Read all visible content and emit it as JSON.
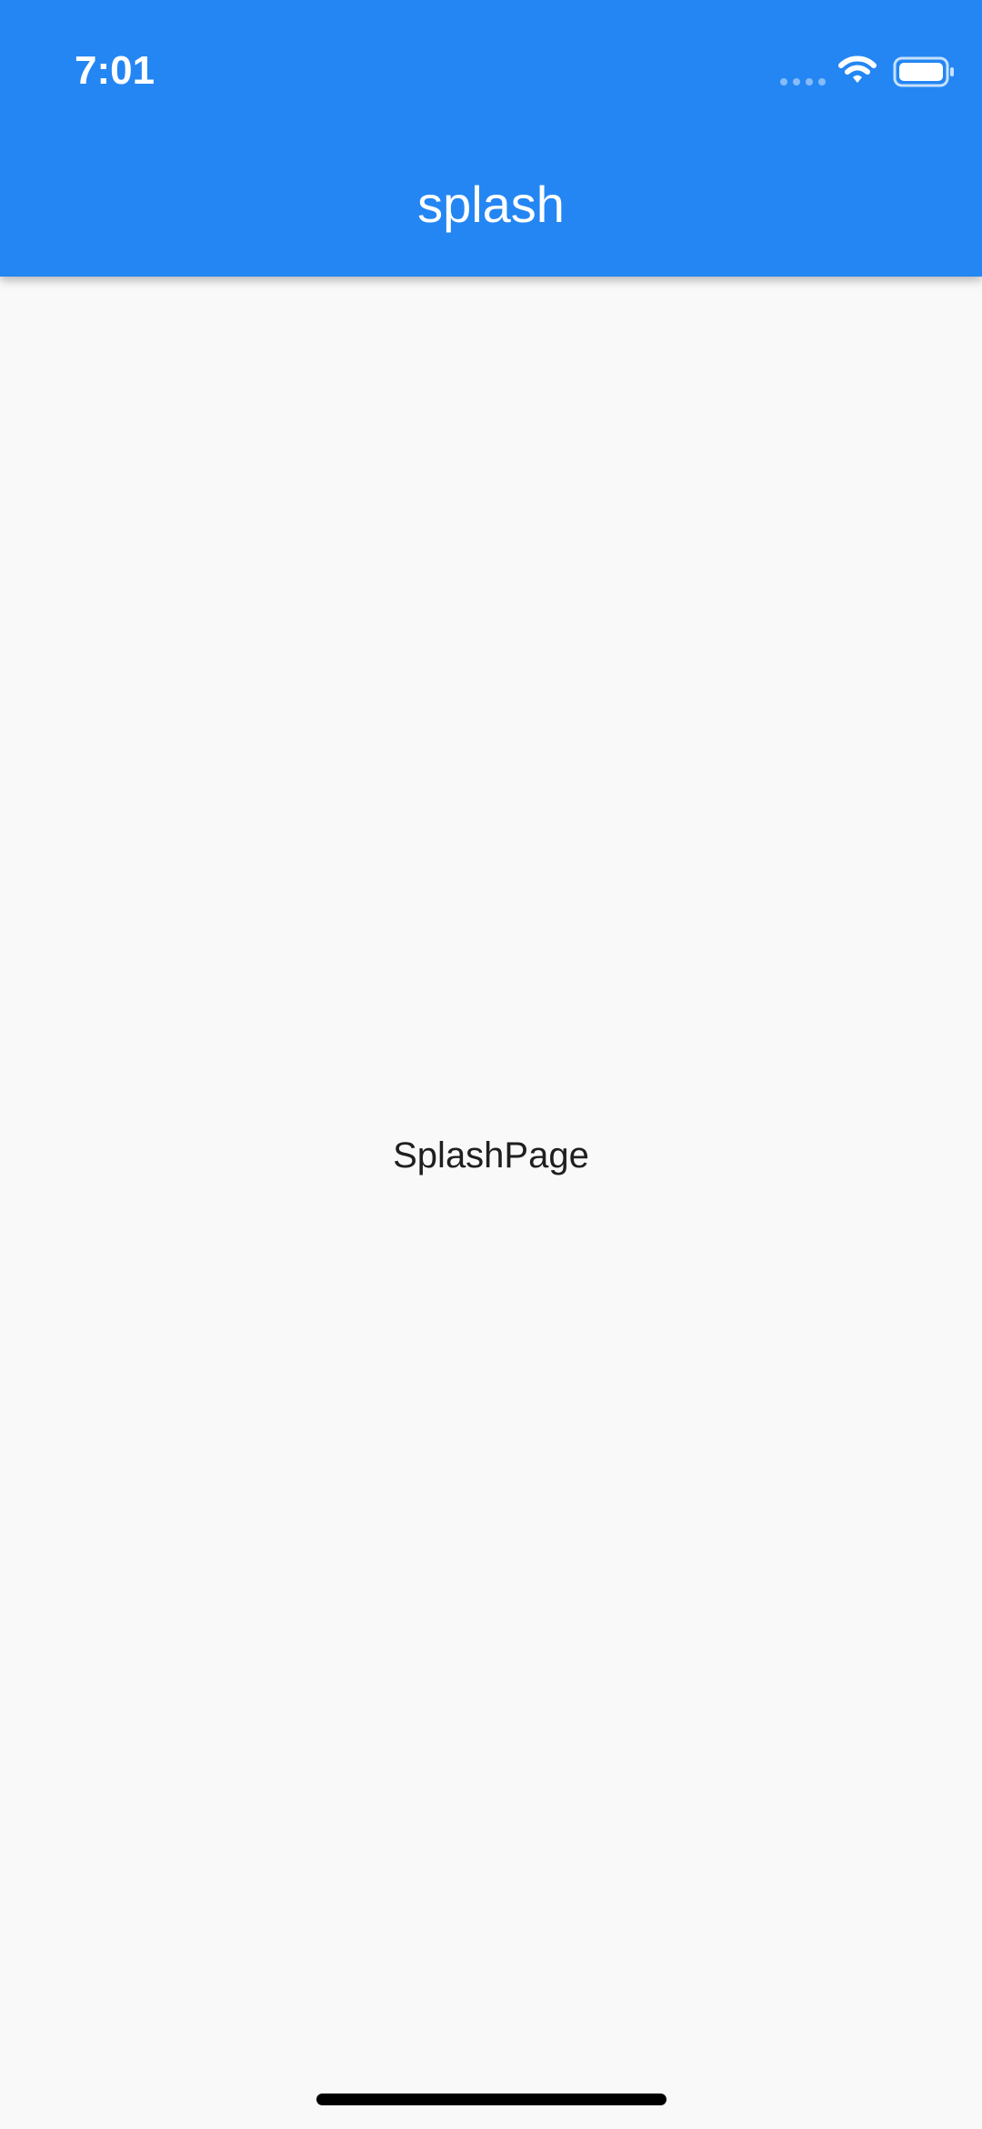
{
  "status_bar": {
    "time": "7:01",
    "signal_icon": "signal-dots-icon",
    "wifi_icon": "wifi-icon",
    "battery_icon": "battery-icon"
  },
  "app_bar": {
    "title": "splash",
    "background_color": "#2486f3",
    "text_color": "#ffffff"
  },
  "main": {
    "center_text": "SplashPage",
    "background_color": "#f9f9f9"
  },
  "system": {
    "home_indicator_icon": "home-indicator"
  }
}
